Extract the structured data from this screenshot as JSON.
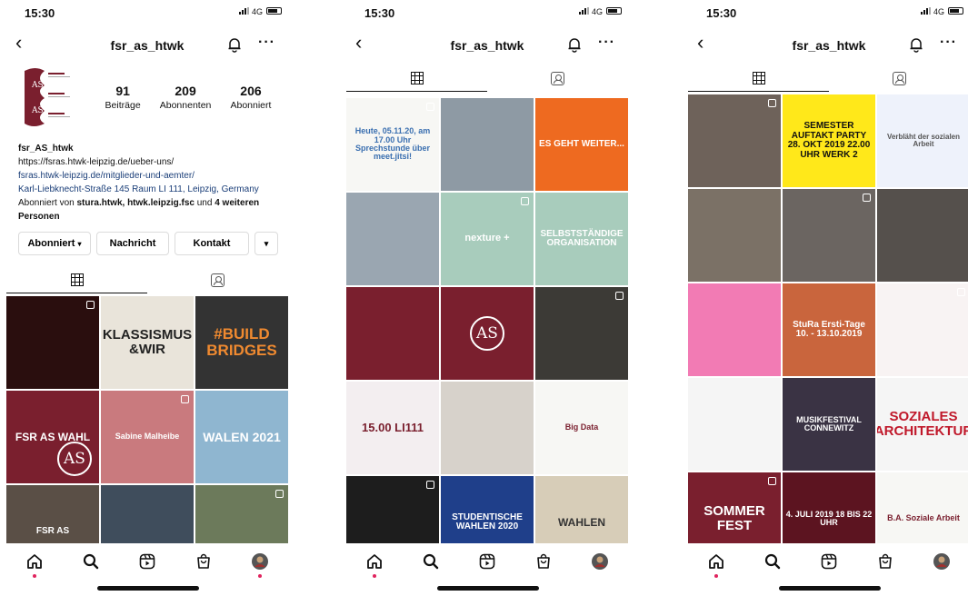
{
  "status": {
    "time": "15:30",
    "network": "4G"
  },
  "header": {
    "username": "fsr_as_htwk"
  },
  "profile": {
    "avatar_text": "AS",
    "stats": [
      {
        "value": "91",
        "label": "Beiträge"
      },
      {
        "value": "209",
        "label": "Abonnenten"
      },
      {
        "value": "206",
        "label": "Abonniert"
      }
    ],
    "name": "fsr_AS_htwk",
    "links": [
      "https://fsras.htwk-leipzig.de/ueber-uns/",
      "fsras.htwk-leipzig.de/mitglieder-und-aemter/",
      "Karl-Liebknecht-Straße 145 Raum LI 111, Leipzig, Germany"
    ],
    "followed_prefix": "Abonniert von ",
    "followed_accounts": "stura.htwk, htwk.leipzig.fsc",
    "followed_mid": " und ",
    "followed_more": "4 weiteren Personen"
  },
  "buttons": {
    "following": "Abonniert",
    "message": "Nachricht",
    "contact": "Kontakt"
  },
  "colors": {
    "accent": "#7a1f2e",
    "link": "#1a3e78",
    "notify_dot": "#e0245e"
  },
  "grid1": [
    {
      "bg": "#2a0e0e",
      "fg": "#ff8a1e",
      "text": "",
      "size": 9
    },
    {
      "bg": "#e9e4da",
      "fg": "#222222",
      "text": "KLASSISMUS &WIR",
      "size": 15
    },
    {
      "bg": "#333333",
      "fg": "#f08a30",
      "text": "#BUILD BRIDGES",
      "size": 17
    },
    {
      "bg": "#7a1f2e",
      "fg": "#ffffff",
      "text": "FSR AS WAHL",
      "size": 12,
      "logo": true
    },
    {
      "bg": "#c97a7e",
      "fg": "#ffffff",
      "text": "Sabine Malheibe",
      "size": 9
    },
    {
      "bg": "#8fb6d0",
      "fg": "#ffffff",
      "text": "WALEN 2021",
      "size": 14
    },
    {
      "bg": "#5a4f46",
      "fg": "#ffffff",
      "text": "FSR AS",
      "size": 10
    },
    {
      "bg": "#3f4d5c",
      "fg": "#ffffff",
      "text": "",
      "size": 9
    },
    {
      "bg": "#6c7a5b",
      "fg": "#ffffff",
      "text": "",
      "size": 9
    }
  ],
  "grid2": [
    {
      "bg": "#f7f7f4",
      "fg": "#3a6fb0",
      "text": "Heute, 05.11.20, am 17.00 Uhr Sprechstunde über meet.jitsi!",
      "size": 9
    },
    {
      "bg": "#8e9aa4",
      "fg": "#ffffff",
      "text": "",
      "size": 9
    },
    {
      "bg": "#ee6a20",
      "fg": "#ffffff",
      "text": "ES GEHT WEITER...",
      "size": 10
    },
    {
      "bg": "#9aa6b1",
      "fg": "#ffffff",
      "text": "",
      "size": 9
    },
    {
      "bg": "#a8ccbc",
      "fg": "#ffffff",
      "text": "nexture +",
      "size": 11
    },
    {
      "bg": "#a8ccbc",
      "fg": "#ffffff",
      "text": "SELBSTSTÄNDIGE ORGANISATION",
      "size": 10
    },
    {
      "bg": "#7a1f2e",
      "fg": "#ffffff",
      "text": "",
      "size": 9
    },
    {
      "bg": "#7a1f2e",
      "fg": "#ffffff",
      "text": "",
      "size": 9,
      "logo": true
    },
    {
      "bg": "#3c3a36",
      "fg": "#f4d06b",
      "text": "",
      "size": 9
    },
    {
      "bg": "#f3eef0",
      "fg": "#7a1f2e",
      "text": "15.00 LI111",
      "size": 13
    },
    {
      "bg": "#d7d2cb",
      "fg": "#333333",
      "text": "",
      "size": 9
    },
    {
      "bg": "#f7f7f4",
      "fg": "#7a1f2e",
      "text": "Big Data",
      "size": 9
    },
    {
      "bg": "#1d1d1d",
      "fg": "#ffffff",
      "text": "",
      "size": 9
    },
    {
      "bg": "#1f3f8a",
      "fg": "#ffffff",
      "text": "STUDENTISCHE WAHLEN 2020",
      "size": 10
    },
    {
      "bg": "#d7cdb8",
      "fg": "#333333",
      "text": "WAHLEN",
      "size": 12
    }
  ],
  "grid3": [
    {
      "bg": "#6e625a",
      "fg": "#ffffff",
      "text": "",
      "size": 9
    },
    {
      "bg": "#ffe81a",
      "fg": "#111111",
      "text": "SEMESTER AUFTAKT PARTY 28. OKT 2019 22.00 UHR WERK 2",
      "size": 10
    },
    {
      "bg": "#eef2fb",
      "fg": "#555555",
      "text": "Verbläht der sozialen Arbeit",
      "size": 8
    },
    {
      "bg": "#7b7166",
      "fg": "#ffffff",
      "text": "",
      "size": 9
    },
    {
      "bg": "#6b6561",
      "fg": "#ffffff",
      "text": "",
      "size": 9
    },
    {
      "bg": "#55504c",
      "fg": "#ffffff",
      "text": "",
      "size": 9
    },
    {
      "bg": "#f27bb4",
      "fg": "#ffffff",
      "text": "",
      "size": 9
    },
    {
      "bg": "#c9653d",
      "fg": "#ffffff",
      "text": "StuRa Ersti-Tage 10. - 13.10.2019",
      "size": 10
    },
    {
      "bg": "#f8f3f3",
      "fg": "#c0182a",
      "text": "",
      "size": 9
    },
    {
      "bg": "#f5f5f5",
      "fg": "#333333",
      "text": "",
      "size": 9
    },
    {
      "bg": "#3a3344",
      "fg": "#ffffff",
      "text": "MUSIKFESTIVAL CONNEWITZ",
      "size": 9
    },
    {
      "bg": "#f5f5f5",
      "fg": "#c0182a",
      "text": "SOZIALES ARCHITEKTUR",
      "size": 15
    },
    {
      "bg": "#7a1f2e",
      "fg": "#ffffff",
      "text": "SOMMER FEST",
      "size": 15
    },
    {
      "bg": "#5c1420",
      "fg": "#ffffff",
      "text": "4. JULI 2019 18 BIS 22 UHR",
      "size": 9
    },
    {
      "bg": "#f7f7f4",
      "fg": "#7a1f2e",
      "text": "B.A. Soziale Arbeit",
      "size": 9
    }
  ]
}
